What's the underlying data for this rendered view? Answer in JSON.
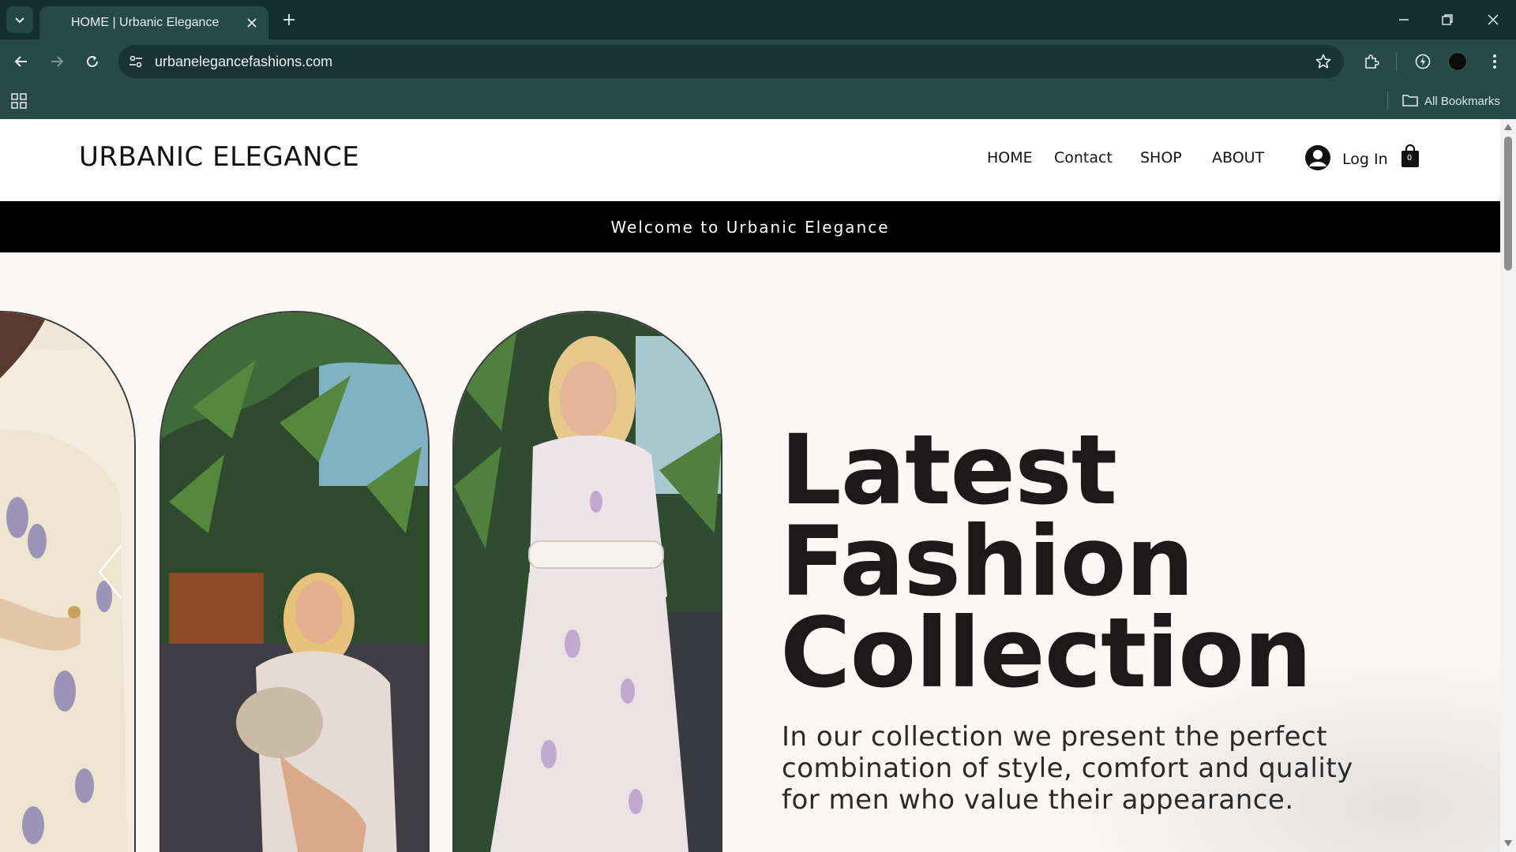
{
  "browser": {
    "tab_title": "HOME | Urbanic Elegance",
    "url": "urbanelegancefashions.com",
    "bookmarks_label": "All Bookmarks",
    "icons": [
      "tab-search-icon",
      "close-icon",
      "plus-icon",
      "minimize-icon",
      "restore-icon",
      "close-window-icon",
      "back-icon",
      "forward-icon",
      "reload-icon",
      "tune-icon",
      "star-icon",
      "extensions-icon",
      "performance-icon",
      "profile-avatar",
      "more-vert-icon",
      "apps-grid-icon",
      "folder-icon"
    ]
  },
  "site": {
    "logo": "URBANIC ELEGANCE",
    "nav": {
      "home": "HOME",
      "contact": "Contact",
      "shop": "SHOP",
      "about": "ABOUT"
    },
    "login_label": "Log In",
    "cart_count": "0",
    "announcement": "Welcome to Urbanic Elegance"
  },
  "hero": {
    "headline_line1": "Latest",
    "headline_line2": "Fashion",
    "headline_line3": "Collection",
    "subtext": "In our collection we present the perfect combination of style, comfort and quality for men who value their appearance.",
    "images": [
      "model-in-floral-dress-closeup",
      "model-seated-with-handbag",
      "model-standing-in-floral-dress"
    ]
  },
  "colors": {
    "chrome_dark": "#14302e",
    "chrome_toolbar": "#264a48",
    "announcement_bg": "#000000",
    "page_bg": "#fbf8f6",
    "headline": "#1b1919"
  }
}
